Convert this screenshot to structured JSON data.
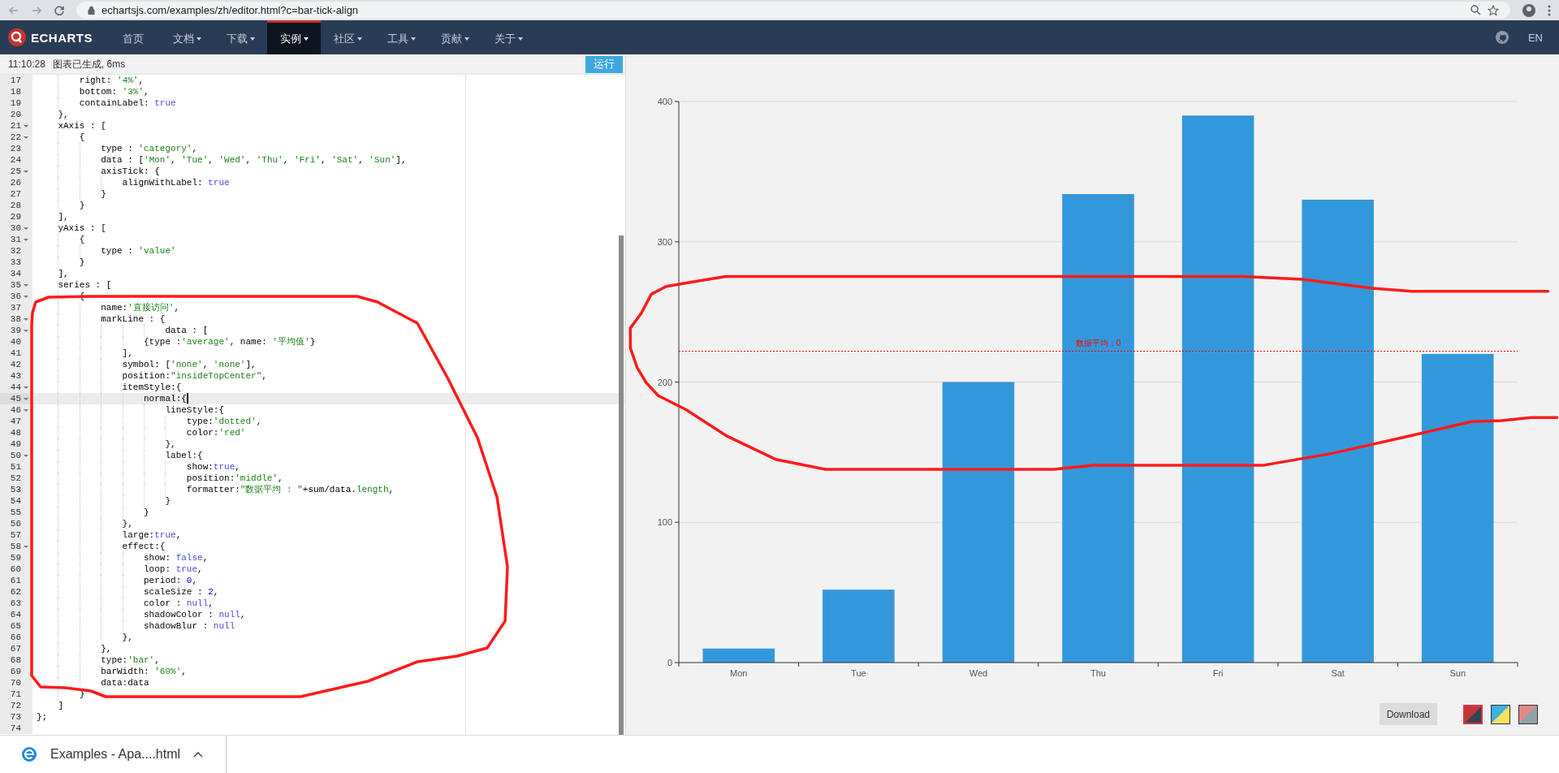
{
  "browser": {
    "url": "echartsjs.com/examples/zh/editor.html?c=bar-tick-align"
  },
  "nav": {
    "brand": "ECHARTS",
    "items": [
      {
        "label": "首页",
        "dropdown": false,
        "selected": false
      },
      {
        "label": "文档",
        "dropdown": true,
        "selected": false
      },
      {
        "label": "下载",
        "dropdown": true,
        "selected": false
      },
      {
        "label": "实例",
        "dropdown": true,
        "selected": true
      },
      {
        "label": "社区",
        "dropdown": true,
        "selected": false
      },
      {
        "label": "工具",
        "dropdown": true,
        "selected": false
      },
      {
        "label": "贡献",
        "dropdown": true,
        "selected": false
      },
      {
        "label": "关于",
        "dropdown": true,
        "selected": false
      }
    ],
    "language": "EN"
  },
  "status": {
    "time": "11:10:28",
    "message": "图表已生成, 6ms",
    "run_button": "运行"
  },
  "editor": {
    "lines": [
      {
        "n": "17",
        "fold": false,
        "active": false,
        "segs": [
          {
            "text": "        right: ",
            "kind": "plain"
          },
          {
            "text": "'4%'",
            "kind": "string"
          },
          {
            "text": ",",
            "kind": "plain"
          }
        ]
      },
      {
        "n": "18",
        "fold": false,
        "active": false,
        "segs": [
          {
            "text": "        bottom: ",
            "kind": "plain"
          },
          {
            "text": "'3%'",
            "kind": "string"
          },
          {
            "text": ",",
            "kind": "plain"
          }
        ]
      },
      {
        "n": "19",
        "fold": false,
        "active": false,
        "segs": [
          {
            "text": "        containLabel: ",
            "kind": "plain"
          },
          {
            "text": "true",
            "kind": "atom"
          }
        ]
      },
      {
        "n": "20",
        "fold": false,
        "active": false,
        "segs": [
          {
            "text": "    },",
            "kind": "plain"
          }
        ]
      },
      {
        "n": "21",
        "fold": true,
        "active": false,
        "segs": [
          {
            "text": "    xAxis : [",
            "kind": "plain"
          }
        ]
      },
      {
        "n": "22",
        "fold": true,
        "active": false,
        "segs": [
          {
            "text": "        {",
            "kind": "plain"
          }
        ]
      },
      {
        "n": "23",
        "fold": false,
        "active": false,
        "segs": [
          {
            "text": "            type : ",
            "kind": "plain"
          },
          {
            "text": "'category'",
            "kind": "string"
          },
          {
            "text": ",",
            "kind": "plain"
          }
        ]
      },
      {
        "n": "24",
        "fold": false,
        "active": false,
        "segs": [
          {
            "text": "            data : [",
            "kind": "plain"
          },
          {
            "text": "'Mon'",
            "kind": "string"
          },
          {
            "text": ", ",
            "kind": "plain"
          },
          {
            "text": "'Tue'",
            "kind": "string"
          },
          {
            "text": ", ",
            "kind": "plain"
          },
          {
            "text": "'Wed'",
            "kind": "string"
          },
          {
            "text": ", ",
            "kind": "plain"
          },
          {
            "text": "'Thu'",
            "kind": "string"
          },
          {
            "text": ", ",
            "kind": "plain"
          },
          {
            "text": "'Fri'",
            "kind": "string"
          },
          {
            "text": ", ",
            "kind": "plain"
          },
          {
            "text": "'Sat'",
            "kind": "string"
          },
          {
            "text": ", ",
            "kind": "plain"
          },
          {
            "text": "'Sun'",
            "kind": "string"
          },
          {
            "text": "],",
            "kind": "plain"
          }
        ]
      },
      {
        "n": "25",
        "fold": true,
        "active": false,
        "segs": [
          {
            "text": "            axisTick: {",
            "kind": "plain"
          }
        ]
      },
      {
        "n": "26",
        "fold": false,
        "active": false,
        "segs": [
          {
            "text": "                alignWithLabel: ",
            "kind": "plain"
          },
          {
            "text": "true",
            "kind": "atom"
          }
        ]
      },
      {
        "n": "27",
        "fold": false,
        "active": false,
        "segs": [
          {
            "text": "            }",
            "kind": "plain"
          }
        ]
      },
      {
        "n": "28",
        "fold": false,
        "active": false,
        "segs": [
          {
            "text": "        }",
            "kind": "plain"
          }
        ]
      },
      {
        "n": "29",
        "fold": false,
        "active": false,
        "segs": [
          {
            "text": "    ],",
            "kind": "plain"
          }
        ]
      },
      {
        "n": "30",
        "fold": true,
        "active": false,
        "segs": [
          {
            "text": "    yAxis : [",
            "kind": "plain"
          }
        ]
      },
      {
        "n": "31",
        "fold": true,
        "active": false,
        "segs": [
          {
            "text": "        {",
            "kind": "plain"
          }
        ]
      },
      {
        "n": "32",
        "fold": false,
        "active": false,
        "segs": [
          {
            "text": "            type : ",
            "kind": "plain"
          },
          {
            "text": "'value'",
            "kind": "string"
          }
        ]
      },
      {
        "n": "33",
        "fold": false,
        "active": false,
        "segs": [
          {
            "text": "        }",
            "kind": "plain"
          }
        ]
      },
      {
        "n": "34",
        "fold": false,
        "active": false,
        "segs": [
          {
            "text": "    ],",
            "kind": "plain"
          }
        ]
      },
      {
        "n": "35",
        "fold": true,
        "active": false,
        "segs": [
          {
            "text": "    series : [",
            "kind": "plain"
          }
        ]
      },
      {
        "n": "36",
        "fold": true,
        "active": false,
        "segs": [
          {
            "text": "        {",
            "kind": "plain"
          }
        ]
      },
      {
        "n": "37",
        "fold": false,
        "active": false,
        "segs": [
          {
            "text": "            name:",
            "kind": "plain"
          },
          {
            "text": "'直接访问'",
            "kind": "string"
          },
          {
            "text": ",",
            "kind": "plain"
          }
        ]
      },
      {
        "n": "38",
        "fold": true,
        "active": false,
        "segs": [
          {
            "text": "            markLine : {",
            "kind": "plain"
          }
        ]
      },
      {
        "n": "39",
        "fold": true,
        "active": false,
        "segs": [
          {
            "text": "                        data : [",
            "kind": "plain"
          }
        ]
      },
      {
        "n": "40",
        "fold": false,
        "active": false,
        "segs": [
          {
            "text": "                    {type :",
            "kind": "plain"
          },
          {
            "text": "'average'",
            "kind": "string"
          },
          {
            "text": ", name: ",
            "kind": "plain"
          },
          {
            "text": "'平均值'",
            "kind": "string"
          },
          {
            "text": "}",
            "kind": "plain"
          }
        ]
      },
      {
        "n": "41",
        "fold": false,
        "active": false,
        "segs": [
          {
            "text": "                ],",
            "kind": "plain"
          }
        ]
      },
      {
        "n": "42",
        "fold": false,
        "active": false,
        "segs": [
          {
            "text": "                symbol: [",
            "kind": "plain"
          },
          {
            "text": "'none'",
            "kind": "string"
          },
          {
            "text": ", ",
            "kind": "plain"
          },
          {
            "text": "'none'",
            "kind": "string"
          },
          {
            "text": "],",
            "kind": "plain"
          }
        ]
      },
      {
        "n": "43",
        "fold": false,
        "active": false,
        "segs": [
          {
            "text": "                position:",
            "kind": "plain"
          },
          {
            "text": "\"insideTopCenter\"",
            "kind": "string"
          },
          {
            "text": ",",
            "kind": "plain"
          }
        ]
      },
      {
        "n": "44",
        "fold": true,
        "active": false,
        "segs": [
          {
            "text": "                itemStyle:{",
            "kind": "plain"
          }
        ]
      },
      {
        "n": "45",
        "fold": true,
        "active": true,
        "segs": [
          {
            "text": "                    normal:{",
            "kind": "plain"
          }
        ]
      },
      {
        "n": "46",
        "fold": true,
        "active": false,
        "segs": [
          {
            "text": "                        lineStyle:{",
            "kind": "plain"
          }
        ]
      },
      {
        "n": "47",
        "fold": false,
        "active": false,
        "segs": [
          {
            "text": "                            type:",
            "kind": "plain"
          },
          {
            "text": "'dotted'",
            "kind": "string"
          },
          {
            "text": ",",
            "kind": "plain"
          }
        ]
      },
      {
        "n": "48",
        "fold": false,
        "active": false,
        "segs": [
          {
            "text": "                            color:",
            "kind": "plain"
          },
          {
            "text": "'red'",
            "kind": "string"
          }
        ]
      },
      {
        "n": "49",
        "fold": false,
        "active": false,
        "segs": [
          {
            "text": "                        },",
            "kind": "plain"
          }
        ]
      },
      {
        "n": "50",
        "fold": true,
        "active": false,
        "segs": [
          {
            "text": "                        label:{",
            "kind": "plain"
          }
        ]
      },
      {
        "n": "51",
        "fold": false,
        "active": false,
        "segs": [
          {
            "text": "                            show:",
            "kind": "plain"
          },
          {
            "text": "true",
            "kind": "atom"
          },
          {
            "text": ",",
            "kind": "plain"
          }
        ]
      },
      {
        "n": "52",
        "fold": false,
        "active": false,
        "segs": [
          {
            "text": "                            position:",
            "kind": "plain"
          },
          {
            "text": "'middle'",
            "kind": "string"
          },
          {
            "text": ",",
            "kind": "plain"
          }
        ]
      },
      {
        "n": "53",
        "fold": false,
        "active": false,
        "segs": [
          {
            "text": "                            formatter:",
            "kind": "plain"
          },
          {
            "text": "\"数据平均 : \"",
            "kind": "string"
          },
          {
            "text": "+sum/data.",
            "kind": "plain"
          },
          {
            "text": "length",
            "kind": "property"
          },
          {
            "text": ",",
            "kind": "plain"
          }
        ]
      },
      {
        "n": "54",
        "fold": false,
        "active": false,
        "segs": [
          {
            "text": "                        }",
            "kind": "plain"
          }
        ]
      },
      {
        "n": "55",
        "fold": false,
        "active": false,
        "segs": [
          {
            "text": "                    }",
            "kind": "plain"
          }
        ]
      },
      {
        "n": "56",
        "fold": false,
        "active": false,
        "segs": [
          {
            "text": "                },",
            "kind": "plain"
          }
        ]
      },
      {
        "n": "57",
        "fold": false,
        "active": false,
        "segs": [
          {
            "text": "                large:",
            "kind": "plain"
          },
          {
            "text": "true",
            "kind": "atom"
          },
          {
            "text": ",",
            "kind": "plain"
          }
        ]
      },
      {
        "n": "58",
        "fold": true,
        "active": false,
        "segs": [
          {
            "text": "                effect:{",
            "kind": "plain"
          }
        ]
      },
      {
        "n": "59",
        "fold": false,
        "active": false,
        "segs": [
          {
            "text": "                    show: ",
            "kind": "plain"
          },
          {
            "text": "false",
            "kind": "atom"
          },
          {
            "text": ",",
            "kind": "plain"
          }
        ]
      },
      {
        "n": "60",
        "fold": false,
        "active": false,
        "segs": [
          {
            "text": "                    loop: ",
            "kind": "plain"
          },
          {
            "text": "true",
            "kind": "atom"
          },
          {
            "text": ",",
            "kind": "plain"
          }
        ]
      },
      {
        "n": "61",
        "fold": false,
        "active": false,
        "segs": [
          {
            "text": "                    period: ",
            "kind": "plain"
          },
          {
            "text": "0",
            "kind": "number"
          },
          {
            "text": ",",
            "kind": "plain"
          }
        ]
      },
      {
        "n": "62",
        "fold": false,
        "active": false,
        "segs": [
          {
            "text": "                    scaleSize : ",
            "kind": "plain"
          },
          {
            "text": "2",
            "kind": "number"
          },
          {
            "text": ",",
            "kind": "plain"
          }
        ]
      },
      {
        "n": "63",
        "fold": false,
        "active": false,
        "segs": [
          {
            "text": "                    color : ",
            "kind": "plain"
          },
          {
            "text": "null",
            "kind": "atom"
          },
          {
            "text": ",",
            "kind": "plain"
          }
        ]
      },
      {
        "n": "64",
        "fold": false,
        "active": false,
        "segs": [
          {
            "text": "                    shadowColor : ",
            "kind": "plain"
          },
          {
            "text": "null",
            "kind": "atom"
          },
          {
            "text": ",",
            "kind": "plain"
          }
        ]
      },
      {
        "n": "65",
        "fold": false,
        "active": false,
        "segs": [
          {
            "text": "                    shadowBlur : ",
            "kind": "plain"
          },
          {
            "text": "null",
            "kind": "atom"
          }
        ]
      },
      {
        "n": "66",
        "fold": false,
        "active": false,
        "segs": [
          {
            "text": "                },",
            "kind": "plain"
          }
        ]
      },
      {
        "n": "67",
        "fold": false,
        "active": false,
        "segs": [
          {
            "text": "            },",
            "kind": "plain"
          }
        ]
      },
      {
        "n": "68",
        "fold": false,
        "active": false,
        "segs": [
          {
            "text": "            type:",
            "kind": "plain"
          },
          {
            "text": "'bar'",
            "kind": "string"
          },
          {
            "text": ",",
            "kind": "plain"
          }
        ]
      },
      {
        "n": "69",
        "fold": false,
        "active": false,
        "segs": [
          {
            "text": "            barWidth: ",
            "kind": "plain"
          },
          {
            "text": "'60%'",
            "kind": "string"
          },
          {
            "text": ",",
            "kind": "plain"
          }
        ]
      },
      {
        "n": "70",
        "fold": false,
        "active": false,
        "segs": [
          {
            "text": "            data:data",
            "kind": "plain"
          }
        ]
      },
      {
        "n": "71",
        "fold": false,
        "active": false,
        "segs": [
          {
            "text": "        }",
            "kind": "plain"
          }
        ]
      },
      {
        "n": "72",
        "fold": false,
        "active": false,
        "segs": [
          {
            "text": "    ]",
            "kind": "plain"
          }
        ]
      },
      {
        "n": "73",
        "fold": false,
        "active": false,
        "segs": [
          {
            "text": "};",
            "kind": "plain"
          }
        ]
      },
      {
        "n": "74",
        "fold": false,
        "active": false
      }
    ]
  },
  "chart": {
    "chart_data": {
      "type": "bar",
      "categories": [
        "Mon",
        "Tue",
        "Wed",
        "Thu",
        "Fri",
        "Sat",
        "Sun"
      ],
      "series": [
        {
          "color": "#3398db",
          "values": [
            10,
            52,
            200,
            334,
            390,
            330,
            220
          ]
        }
      ],
      "ylim": [
        0,
        400
      ],
      "yticks": [
        0,
        100,
        200,
        300,
        400
      ],
      "grid": true,
      "ref_lines": [
        {
          "axis": "y",
          "value": 222,
          "label": "数据平均：0"
        }
      ]
    },
    "download_button": "Download",
    "themes": [
      {
        "selected": true,
        "color": "#c23531"
      },
      {
        "selected": false,
        "color": "#3fb1e3"
      },
      {
        "selected": false,
        "color": "#e5898b"
      }
    ]
  },
  "downloads": {
    "file": "Examples - Apa....html"
  }
}
